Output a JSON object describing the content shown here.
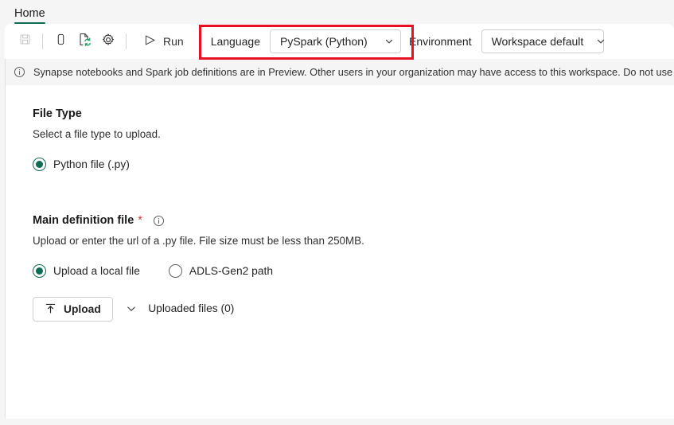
{
  "tabs": [
    {
      "label": "Home",
      "active": true
    }
  ],
  "toolbar": {
    "save_icon": "save-icon",
    "publish_icon": "mobile-device-icon",
    "refresh_icon": "document-refresh-icon",
    "settings_icon": "gear-icon",
    "run_label": "Run",
    "run_icon": "play-triangle-icon",
    "language": {
      "label": "Language",
      "value": "PySpark (Python)",
      "chevron": "chevron-down-icon"
    },
    "environment": {
      "label": "Environment",
      "value": "Workspace default",
      "chevron": "chevron-down-icon"
    }
  },
  "highlight": {
    "color": "#e81123"
  },
  "banner": {
    "icon": "info-circle-icon",
    "text": "Synapse notebooks and Spark job definitions are in Preview. Other users in your organization may have access to this workspace. Do not use these items"
  },
  "file_type": {
    "title": "File Type",
    "description": "Select a file type to upload.",
    "options": [
      {
        "label": "Python file (.py)",
        "selected": true
      }
    ]
  },
  "main_definition": {
    "title": "Main definition file",
    "required_marker": "*",
    "info_icon": "info-circle-icon",
    "description": "Upload or enter the url of a .py file. File size must be less than 250MB.",
    "options": [
      {
        "label": "Upload a local file",
        "selected": true
      },
      {
        "label": "ADLS-Gen2 path",
        "selected": false
      }
    ],
    "upload_button": {
      "label": "Upload",
      "icon": "upload-arrow-icon"
    },
    "uploaded_files": {
      "label": "Uploaded files (0)",
      "chevron": "chevron-down-icon",
      "expanded": true
    }
  },
  "theme": {
    "accent_green": "#0f6c54",
    "required_red": "#d13438",
    "highlight_red": "#e81123"
  }
}
